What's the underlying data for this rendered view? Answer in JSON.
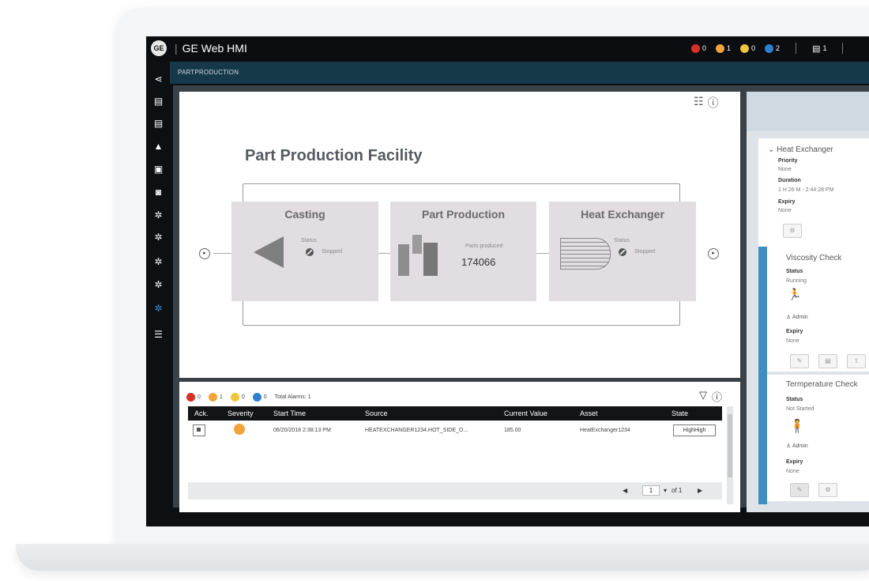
{
  "header": {
    "title": "GE Web HMI",
    "logo": "GE",
    "counters": [
      {
        "color": "#d93025",
        "value": "0"
      },
      {
        "color": "#f3a33a",
        "value": "1"
      },
      {
        "color": "#f0c53a",
        "value": "0"
      },
      {
        "color": "#2d7fd0",
        "value": "2"
      }
    ],
    "panel_count": "1"
  },
  "breadcrumb": "PARTPRODUCTION",
  "sidebar": {
    "icons": [
      "share-icon",
      "server-icon",
      "server-icon",
      "warning-icon",
      "screenshot-icon",
      "camera-icon",
      "gear-icon",
      "gear-icon",
      "gear-icon",
      "gear-icon",
      "gear-active-icon",
      "list-icon"
    ]
  },
  "diagram": {
    "title": "Part Production Facility",
    "blocks": [
      {
        "title": "Casting",
        "status_label": "Status",
        "status_value": "Stopped"
      },
      {
        "title": "Part Production",
        "parts_label": "Parts produced",
        "parts_value": "174066"
      },
      {
        "title": "Heat Exchanger",
        "status_label": "Status",
        "status_value": "Stopped"
      }
    ]
  },
  "alarms": {
    "summary": {
      "red": "0",
      "orange": "1",
      "yellow": "0",
      "blue": "0",
      "total_label": "Total Alarms: 1"
    },
    "columns": [
      "Ack.",
      "Severity",
      "Start Time",
      "Source",
      "Current Value",
      "Asset",
      "State"
    ],
    "rows": [
      {
        "start_time": "06/20/2018 2:38:13 PM",
        "source": "HEATEXCHANGER1234.HOT_SIDE_O...",
        "current_value": "185.00",
        "asset": "HeatExchanger1234",
        "state": "HighHigh"
      }
    ],
    "pager": {
      "page": "1",
      "of": "of 1"
    }
  },
  "right_panel": {
    "heat_exchanger": {
      "title": "Heat Exchanger",
      "priority_label": "Priority",
      "priority_value": "None",
      "duration_label": "Duration",
      "duration_value": "1 H 26 M - 2:44:28 PM",
      "expiry_label": "Expiry",
      "expiry_value": "None"
    },
    "viscosity": {
      "title": "Viscosity Check",
      "status_label": "Status",
      "status_value": "Running",
      "user": "Admin",
      "expiry_label": "Expiry",
      "expiry_value": "None"
    },
    "temperature": {
      "title": "Termperature Check",
      "status_label": "Status",
      "status_value": "Not Started",
      "user": "Admin",
      "expiry_label": "Expiry",
      "expiry_value": "None"
    }
  }
}
